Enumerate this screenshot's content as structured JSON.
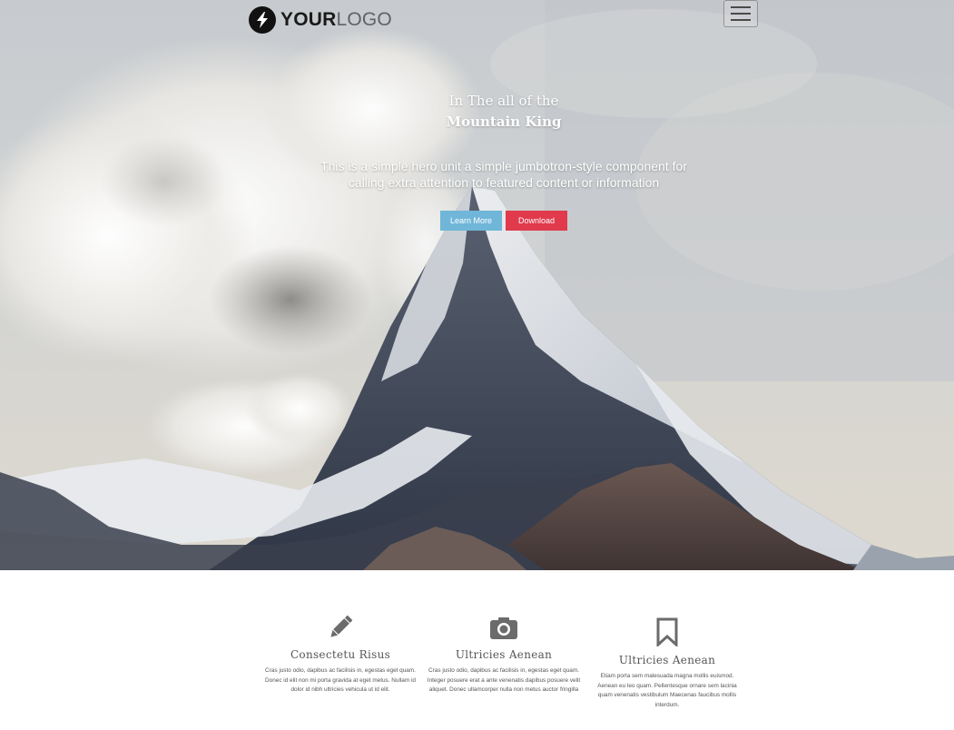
{
  "header": {
    "logo_bold": "YOUR",
    "logo_light": "LOGO",
    "logo_icon": "lightning-bolt-icon",
    "menu_icon": "hamburger-menu-icon"
  },
  "hero": {
    "title_line1": "In The all of the",
    "title_line2": "Mountain King",
    "lead": "This is a simple hero unit a simple jumbotron-style component for calling extra attention to featured content or information",
    "learn_more_label": "Learn More",
    "download_label": "Download"
  },
  "features": [
    {
      "icon": "pencil-icon",
      "title": "Consectetu Risus",
      "text": "Cras justo odio, dapibus ac facilisis in, egestas eget quam. Donec id elit non mi porta gravida at eget metus. Nullam id dolor id nibh ultricies vehicula ut id elit."
    },
    {
      "icon": "camera-icon",
      "title": "Ultricies Aenean",
      "text": "Cras justo odio, dapibus ac facilisis in, egestas eget quam. Integer posuere erat a ante venenatis dapibus posuere velit aliquet. Donec ullamcorper nulla non metus auctor fringilla"
    },
    {
      "icon": "bookmark-icon",
      "title": "Ultricies Aenean",
      "text": "Etiam porta sem malesuada magna mollis euismod. Aenean eu leo quam. Pellentesque ornare sem lacinia quam venenatis vestibulum Maecenas faucibus mollis interdum."
    }
  ],
  "colors": {
    "learn_more": "#6fb6d8",
    "download": "#e03a4c",
    "icon_gray": "#6b6b6b"
  }
}
